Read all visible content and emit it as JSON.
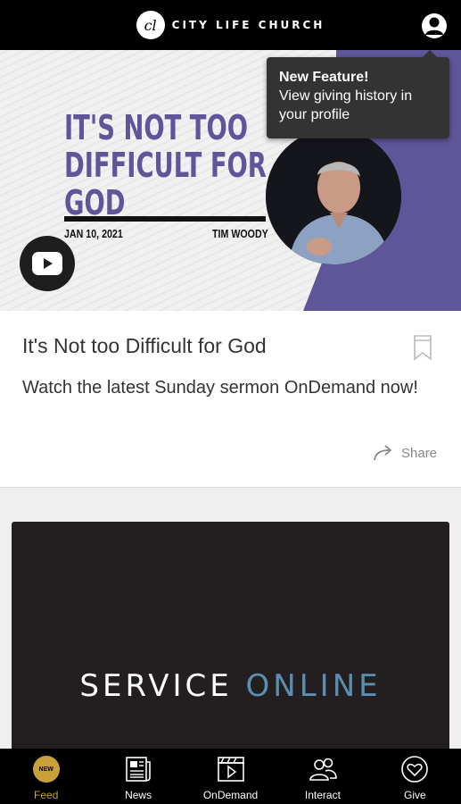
{
  "header": {
    "logo_text": "cl",
    "brand_name": "CITY LIFE CHURCH"
  },
  "tooltip": {
    "title": "New Feature!",
    "body": "View giving history in your profile"
  },
  "hero": {
    "title_line1": "IT'S NOT TOO",
    "title_line2": "DIFFICULT FOR",
    "title_line3": "GOD",
    "date": "JAN 10, 2021",
    "speaker": "TIM WOODY",
    "colors": {
      "accent": "#5e5699"
    }
  },
  "card": {
    "title": "It's Not too Difficult for God",
    "description": "Watch the latest Sunday sermon OnDemand now!",
    "share_label": "Share"
  },
  "service_card": {
    "word1": "SERVICE",
    "word2": "ONLINE"
  },
  "nav": {
    "items": [
      {
        "label": "Feed",
        "icon": "new-badge",
        "badge": "NEW",
        "active": true
      },
      {
        "label": "News",
        "icon": "newspaper-icon"
      },
      {
        "label": "OnDemand",
        "icon": "clapperboard-icon"
      },
      {
        "label": "Interact",
        "icon": "people-icon"
      },
      {
        "label": "Give",
        "icon": "heart-icon"
      }
    ],
    "active_color": "#c9a13a"
  }
}
